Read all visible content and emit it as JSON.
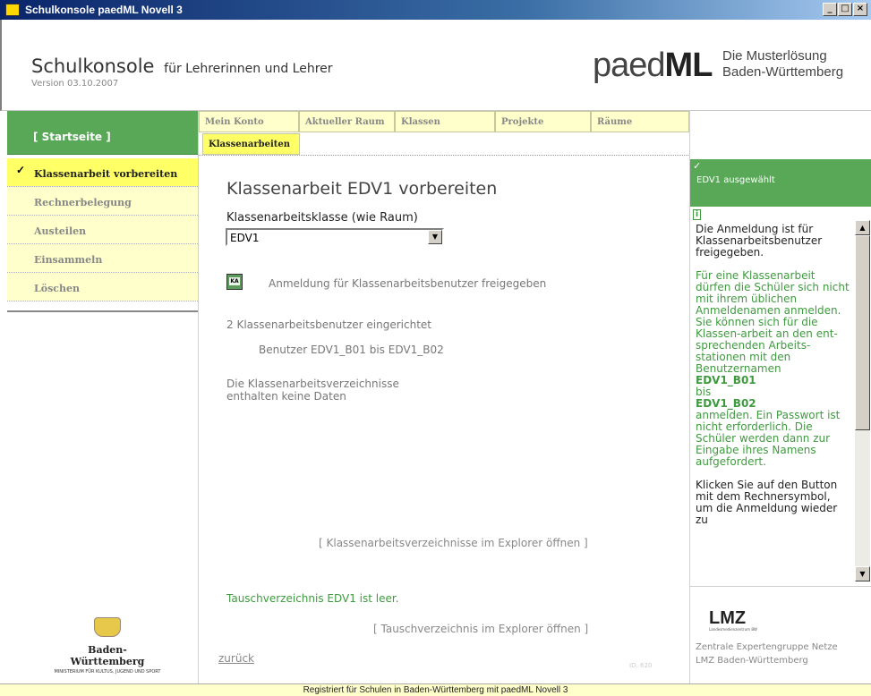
{
  "window": {
    "title": "Schulkonsole paedML Novell 3",
    "buttons": [
      "_",
      "□",
      "×"
    ]
  },
  "header": {
    "brand": "Schulkonsole",
    "brand_sub": "für Lehrerinnen und Lehrer",
    "version": "Version 03.10.2007",
    "logo_light": "paed",
    "logo_bold": "ML",
    "logo_tag_line1": "Die Musterlösung",
    "logo_tag_line2": "Baden-Württemberg"
  },
  "start": {
    "label": "[ Startseite ]"
  },
  "tabs": [
    {
      "label": "Mein Konto"
    },
    {
      "label": "Aktueller Raum"
    },
    {
      "label": "Klassen"
    },
    {
      "label": "Projekte"
    },
    {
      "label": "Räume"
    },
    {
      "label": "Klassenarbeiten"
    }
  ],
  "sidebar": {
    "items": [
      {
        "label": "Klassenarbeit vorbereiten"
      },
      {
        "label": "Rechnerbelegung"
      },
      {
        "label": "Austeilen"
      },
      {
        "label": "Einsammeln"
      },
      {
        "label": "Löschen"
      }
    ],
    "logo_name": "Baden-Württemberg",
    "logo_ministry": "MINISTERIUM FÜR KULTUS, JUGEND UND SPORT"
  },
  "main": {
    "title": "Klassenarbeit EDV1 vorbereiten",
    "class_label": "Klassenarbeitsklasse (wie Raum)",
    "class_value": "EDV1",
    "ka_icon_text": "KA",
    "login_status": "Anmeldung für Klassenarbeitsbenutzer freigegeben",
    "users_created": "2 Klassenarbeitsbenutzer eingerichtet",
    "users_range": "Benutzer EDV1_B01 bis EDV1_B02",
    "dir_line1": "Die Klassenarbeitsverzeichnisse",
    "dir_line2": "enthalten keine Daten",
    "open_dirs": "[ Klassenarbeitsverzeichnisse im Explorer öffnen ]",
    "swap_empty": "Tauschverzeichnis EDV1 ist leer.",
    "open_swap": "[ Tauschverzeichnis im Explorer öffnen ]",
    "back": "zurück",
    "page_id": "ID: 620"
  },
  "right": {
    "status": "EDV1 ausgewählt",
    "info_icon": "i",
    "help_p1": "Die Anmeldung ist für Klassenarbeitsbenutzer freigegeben.",
    "help_p2a": "Für eine Klassenarbeit dürfen die Schüler sich nicht mit ihrem üblichen Anmeldenamen anmelden. Sie können sich für die Klassen-arbeit an den ent-sprechenden Arbeits-stationen mit den Benutzernamen",
    "help_user1": "EDV1_B01",
    "help_bis": "bis",
    "help_user2": "EDV1_B02",
    "help_p2b": "anmelden. Ein Passwort ist nicht erforderlich. Die Schüler werden dann zur Eingabe ihres Namens aufgefordert.",
    "help_p3": "Klicken Sie auf den Button mit dem Rechnersymbol, um die Anmeldung wieder zu",
    "lmz_logo": "LMZ",
    "lmz_small": "Landesmedienzentrum BW",
    "lmz_line1": "Zentrale Expertengruppe Netze",
    "lmz_line2": "LMZ Baden-Württemberg"
  },
  "footer": {
    "text": "Registriert für Schulen in Baden-Württemberg mit paedML Novell 3"
  }
}
